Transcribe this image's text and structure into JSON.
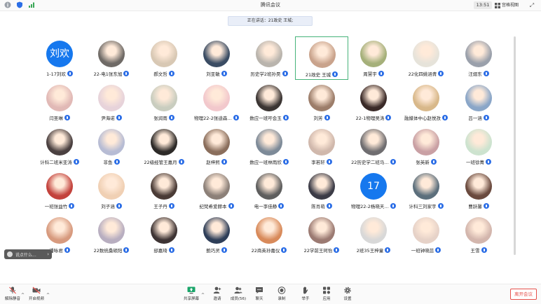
{
  "window": {
    "title": "腾讯会议",
    "time": "13:51",
    "view_mode": "宫格视图"
  },
  "banner": {
    "speaking": "正在讲话：21政史 王城;"
  },
  "colors": {
    "accent": "#1678ee",
    "active_border": "#46b37a",
    "leave": "#e6504b"
  },
  "participants": [
    [
      {
        "name": "1-17刘欢",
        "avatar_text": "刘欢",
        "avatar_color": "#1678ee"
      },
      {
        "name": "22-电1张东旭",
        "avatar_color": "#6f6a66"
      },
      {
        "name": "郝文哲",
        "avatar_color": "#d8c8b4"
      },
      {
        "name": "刘亚敏",
        "avatar_color": "#3a4c63"
      },
      {
        "name": "历史学2班孙昊",
        "avatar_color": "#b9b4ad"
      },
      {
        "name": "21政史 王城",
        "avatar_color": "#c9a38c",
        "active": true
      },
      {
        "name": "周慧宇",
        "avatar_color": "#a5b07a"
      },
      {
        "name": "22化四姚涵青",
        "avatar_color": "#e6e3da"
      },
      {
        "name": "汪熠东",
        "avatar_color": "#9aa0ab"
      }
    ],
    [
      {
        "name": "闫圣琳",
        "avatar_color": "#e1b9b6"
      },
      {
        "name": "尹海诺",
        "avatar_color": "#e7d3da"
      },
      {
        "name": "张润雨",
        "avatar_color": "#c9cdbf"
      },
      {
        "name": "物理22-2张迪森…",
        "avatar_color": "#f2c8cc"
      },
      {
        "name": "数应一班吁会玉",
        "avatar_color": "#3b3533"
      },
      {
        "name": "刘芳",
        "avatar_color": "#9c7d6a"
      },
      {
        "name": "22-1物理吴涛",
        "avatar_color": "#3a2a28"
      },
      {
        "name": "融媒体中心赵悦孜",
        "avatar_color": "#d8b88a"
      },
      {
        "name": "吕一涵",
        "avatar_color": "#8aa6c8"
      }
    ],
    [
      {
        "name": "计科二班米亚涛",
        "avatar_color": "#4a4040"
      },
      {
        "name": "非鱼",
        "avatar_color": "#b7bcd4"
      },
      {
        "name": "22级经管王嘉月",
        "avatar_color": "#2d2a28"
      },
      {
        "name": "赵梓熙",
        "avatar_color": "#8a6e5c"
      },
      {
        "name": "数应一班林雨欣",
        "avatar_color": "#7d8a98"
      },
      {
        "name": "李若轩",
        "avatar_color": "#d0b8ac"
      },
      {
        "name": "22历史学二班马…",
        "avatar_color": "#6f6d70"
      },
      {
        "name": "张英新",
        "avatar_color": "#c9a0a4"
      },
      {
        "name": "一班徐菁",
        "avatar_color": "#cde3cf"
      }
    ],
    [
      {
        "name": "一班张益竹",
        "avatar_color": "#c3423c"
      },
      {
        "name": "刘子涵",
        "avatar_color": "#f0d0b4"
      },
      {
        "name": "王子丹",
        "avatar_color": "#4a3b36"
      },
      {
        "name": "纪梵希爱赫本",
        "avatar_color": "#8c8078"
      },
      {
        "name": "电一李佳静",
        "avatar_color": "#5e5e5e"
      },
      {
        "name": "陈肖萌",
        "avatar_color": "#3b3b46"
      },
      {
        "name": "物理22-2杨晓天…",
        "avatar_text": "17",
        "avatar_color": "#1678ee"
      },
      {
        "name": "计科三刘家宇",
        "avatar_color": "#5c6f7c"
      },
      {
        "name": "曹跃馨",
        "avatar_color": "#6a4a3e"
      }
    ],
    [
      {
        "name": "潘咏君",
        "avatar_color": "#d79a7e"
      },
      {
        "name": "22数统桑硕阳",
        "avatar_color": "#b8aec0"
      },
      {
        "name": "邸嘉琦",
        "avatar_color": "#3e3434"
      },
      {
        "name": "鲍巧灵",
        "avatar_color": "#2e3e58"
      },
      {
        "name": "22商英孙嘉仪",
        "avatar_color": "#d88a5a"
      },
      {
        "name": "22学前王珂怡",
        "avatar_color": "#9b7a72"
      },
      {
        "name": "2班35王梓童",
        "avatar_color": "#d8d8d8"
      },
      {
        "name": "一班钟晓蕊",
        "avatar_color": "#e6d2c8"
      },
      {
        "name": "王雪",
        "avatar_color": "#d3b6ad"
      }
    ]
  ],
  "chat": {
    "placeholder": "说点什么..."
  },
  "toolbar": {
    "mute": "解除静音",
    "video": "开启视频",
    "share": "共享屏幕",
    "invite": "邀请",
    "members": "成员(56)",
    "chat": "聊天",
    "record": "录制",
    "raise_hand": "举手",
    "apps": "应用",
    "settings": "设置",
    "leave": "离开会议"
  }
}
